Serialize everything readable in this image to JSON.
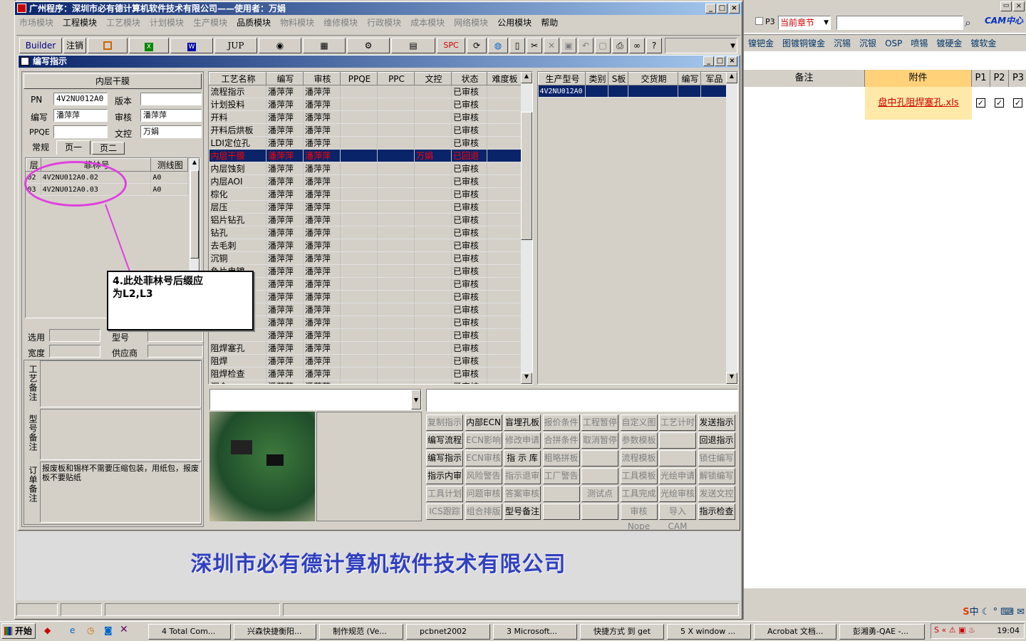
{
  "app": {
    "title": "广州程序：深圳市必有德计算机软件技术有限公司——使用者：万娟"
  },
  "menu": [
    {
      "label": "市场模块",
      "on": false
    },
    {
      "label": "工程模块",
      "on": true
    },
    {
      "label": "工艺模块",
      "on": false
    },
    {
      "label": "计划模块",
      "on": false
    },
    {
      "label": "生产模块",
      "on": false
    },
    {
      "label": "品质模块",
      "on": true
    },
    {
      "label": "物料模块",
      "on": false
    },
    {
      "label": "维修模块",
      "on": false
    },
    {
      "label": "行政模块",
      "on": false
    },
    {
      "label": "成本模块",
      "on": false
    },
    {
      "label": "网络模块",
      "on": false
    },
    {
      "label": "公用模块",
      "on": true
    },
    {
      "label": "帮助",
      "on": true
    }
  ],
  "toolbar": {
    "builder": "Builder",
    "logout": "注销",
    "jup": "JUP",
    "spc": "SPC"
  },
  "right_top": {
    "p3": "P3",
    "chapter": "当前章节",
    "cam": "CAM中心"
  },
  "right_tabs": [
    "镍钯金",
    "图镀铜镍金",
    "沉锡",
    "沉银",
    "OSP",
    "喷锡",
    "镀硬金",
    "镀软金"
  ],
  "right_table": {
    "headers": [
      "备注",
      "附件",
      "P1",
      "P2",
      "P3"
    ],
    "attachment": "盘中孔阻焊塞孔.xls"
  },
  "child": {
    "title": "编写指示"
  },
  "inner": {
    "header": "内层干膜",
    "pn_label": "PN",
    "pn": "4V2NU012A0",
    "version_label": "版本",
    "version": "",
    "writer_label": "编写",
    "writer": "潘萍萍",
    "reviewer_label": "审核",
    "reviewer": "潘萍萍",
    "ppqe_label": "PPQE",
    "ppqe": "",
    "doc_label": "文控",
    "doc": "万娟"
  },
  "tabs": [
    "常规",
    "页一",
    "页二"
  ],
  "layer_table": {
    "headers": [
      "层",
      "菲林号",
      "测线图"
    ],
    "rows": [
      [
        "02",
        "4V2NU012A0.02",
        "A0"
      ],
      [
        "03",
        "4V2NU012A0.03",
        "A0"
      ]
    ]
  },
  "annotation": {
    "line1": "4.此处菲林号后缀应",
    "line2": "为L2,L3"
  },
  "lower_fields": {
    "select": "选用",
    "size": "型号",
    "width": "宽度",
    "supplier": "供应商"
  },
  "remarks": {
    "process": "工艺备注",
    "model": "型号备注",
    "order": "订单备注",
    "order_text": "报废板和锡样不需要压缩包装，用纸包，报废板不要贴纸"
  },
  "process_table": {
    "headers": [
      "工艺名称",
      "编写",
      "审核",
      "PPQE",
      "PPC",
      "文控",
      "状态",
      "难度板"
    ],
    "rows": [
      [
        "流程指示",
        "潘萍萍",
        "潘萍萍",
        "",
        "",
        "",
        "已审核"
      ],
      [
        "计划投料",
        "潘萍萍",
        "潘萍萍",
        "",
        "",
        "",
        "已审核"
      ],
      [
        "开料",
        "潘萍萍",
        "潘萍萍",
        "",
        "",
        "",
        "已审核"
      ],
      [
        "开料后烘板",
        "潘萍萍",
        "潘萍萍",
        "",
        "",
        "",
        "已审核"
      ],
      [
        "LDI定位孔",
        "潘萍萍",
        "潘萍萍",
        "",
        "",
        "",
        "已审核"
      ],
      [
        "内层干膜",
        "潘萍萍",
        "潘萍萍",
        "",
        "",
        "万娟",
        "已回退"
      ],
      [
        "内层蚀刻",
        "潘萍萍",
        "潘萍萍",
        "",
        "",
        "",
        "已审核"
      ],
      [
        "内层AOI",
        "潘萍萍",
        "潘萍萍",
        "",
        "",
        "",
        "已审核"
      ],
      [
        "棕化",
        "潘萍萍",
        "潘萍萍",
        "",
        "",
        "",
        "已审核"
      ],
      [
        "层压",
        "潘萍萍",
        "潘萍萍",
        "",
        "",
        "",
        "已审核"
      ],
      [
        "铝片钻孔",
        "潘萍萍",
        "潘萍萍",
        "",
        "",
        "",
        "已审核"
      ],
      [
        "钻孔",
        "潘萍萍",
        "潘萍萍",
        "",
        "",
        "",
        "已审核"
      ],
      [
        "去毛刺",
        "潘萍萍",
        "潘萍萍",
        "",
        "",
        "",
        "已审核"
      ],
      [
        "沉铜",
        "潘萍萍",
        "潘萍萍",
        "",
        "",
        "",
        "已审核"
      ],
      [
        "负片电镀",
        "潘萍萍",
        "潘萍萍",
        "",
        "",
        "",
        "已审核"
      ],
      [
        "",
        "潘萍萍",
        "潘萍萍",
        "",
        "",
        "",
        "已审核"
      ],
      [
        "",
        "潘萍萍",
        "潘萍萍",
        "",
        "",
        "",
        "已审核"
      ],
      [
        "",
        "潘萍萍",
        "潘萍萍",
        "",
        "",
        "",
        "已审核"
      ],
      [
        "",
        "潘萍萍",
        "潘萍萍",
        "",
        "",
        "",
        "已审核"
      ],
      [
        "",
        "潘萍萍",
        "潘萍萍",
        "",
        "",
        "",
        "已审核"
      ],
      [
        "阻焊塞孔",
        "潘萍萍",
        "潘萍萍",
        "",
        "",
        "",
        "已审核"
      ],
      [
        "阻焊",
        "潘萍萍",
        "潘萍萍",
        "",
        "",
        "",
        "已审核"
      ],
      [
        "阻焊检查",
        "潘萍萍",
        "潘萍萍",
        "",
        "",
        "",
        "已审核"
      ],
      [
        "沉金",
        "潘萍萍",
        "潘萍萍",
        "",
        "",
        "",
        "已审核"
      ]
    ]
  },
  "product_table": {
    "headers": [
      "生产型号",
      "类别",
      "S板",
      "交货期",
      "编写",
      "军品"
    ],
    "rows": [
      [
        "4V2NU012A0",
        "",
        "",
        "",
        "",
        ""
      ]
    ]
  },
  "actions": [
    [
      "复制指示",
      "内部ECN",
      "盲埋孔板",
      "报价条件",
      "工程暂停",
      "自定义图",
      "工艺计时",
      "发送指示"
    ],
    [
      "编写流程",
      "ECN影响",
      "修改申请",
      "合拼条件",
      "取消暂停",
      "参数模板",
      "",
      "回退指示"
    ],
    [
      "编写指示",
      "ECN审核",
      "指 示 库",
      "粗略拼板",
      "",
      "流程模板",
      "",
      "锁住编写"
    ],
    [
      "指示内审",
      "风险警告",
      "指示退审",
      "工厂警告",
      "",
      "工具模板",
      "光绘申请",
      "解锁编写"
    ],
    [
      "工具计划",
      "问题审核",
      "答案审核",
      "",
      "测试点",
      "工具完成",
      "光绘审核",
      "发送文控"
    ],
    [
      "ICS跟踪",
      "组合排版",
      "型号备注",
      "",
      "",
      "审核Nope",
      "导入CAM",
      "指示检查"
    ]
  ],
  "actions_enabled": [
    [
      0,
      1,
      1,
      0,
      0,
      0,
      0,
      1
    ],
    [
      1,
      0,
      0,
      0,
      0,
      0,
      0,
      1
    ],
    [
      1,
      0,
      1,
      0,
      0,
      0,
      0,
      0
    ],
    [
      1,
      0,
      0,
      0,
      0,
      0,
      0,
      0
    ],
    [
      0,
      0,
      0,
      0,
      0,
      0,
      0,
      0
    ],
    [
      0,
      0,
      1,
      0,
      0,
      0,
      0,
      1
    ]
  ],
  "banner": "深圳市必有德计算机软件技术有限公司",
  "taskbar": {
    "start": "开始",
    "items": [
      "4 Total Com...",
      "兴森快捷衡阳...",
      "制作规范 (Ve...",
      "pcbnet2002",
      "3 Microsoft...",
      "快捷方式 到 get",
      "5 X window ...",
      "Acrobat 文档...",
      "彭湘勇-QAE -..."
    ],
    "clock": "19:04",
    "ime": "中"
  }
}
